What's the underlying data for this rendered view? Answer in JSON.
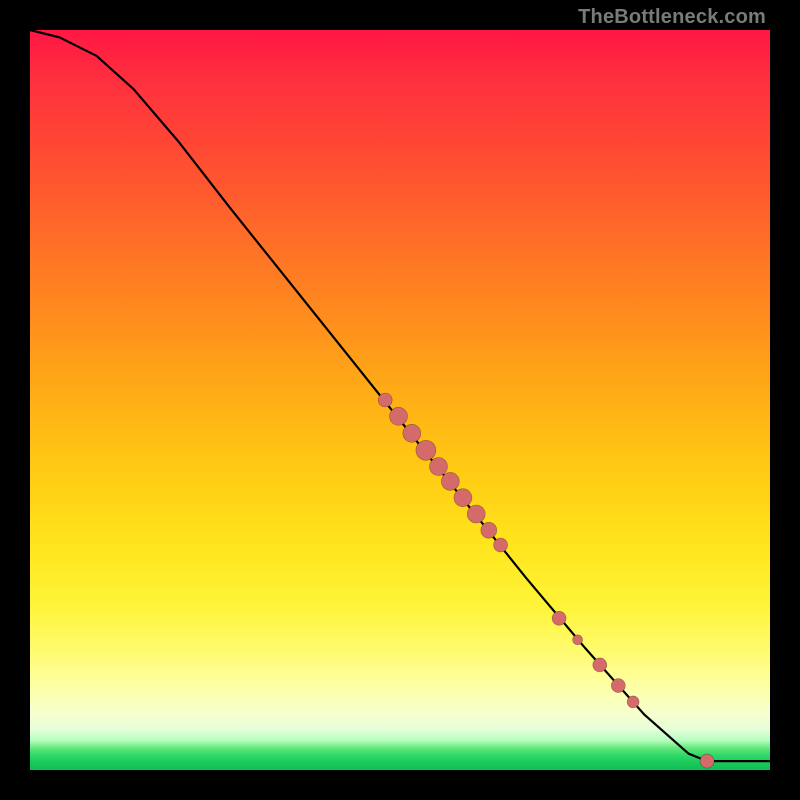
{
  "watermark": "TheBottleneck.com",
  "colors": {
    "dot": "#d46a6a",
    "curve": "#000000"
  },
  "chart_data": {
    "type": "scatter",
    "title": "",
    "xlabel": "",
    "ylabel": "",
    "xlim": [
      0,
      1
    ],
    "ylim": [
      0,
      1
    ],
    "curve": [
      [
        0.0,
        1.0
      ],
      [
        0.04,
        0.99
      ],
      [
        0.09,
        0.965
      ],
      [
        0.14,
        0.92
      ],
      [
        0.2,
        0.85
      ],
      [
        0.27,
        0.76
      ],
      [
        0.35,
        0.66
      ],
      [
        0.43,
        0.56
      ],
      [
        0.51,
        0.46
      ],
      [
        0.59,
        0.36
      ],
      [
        0.67,
        0.26
      ],
      [
        0.75,
        0.165
      ],
      [
        0.83,
        0.075
      ],
      [
        0.89,
        0.022
      ],
      [
        0.915,
        0.012
      ],
      [
        0.93,
        0.012
      ],
      [
        1.0,
        0.012
      ]
    ],
    "series": [
      {
        "name": "points",
        "points": [
          {
            "x": 0.48,
            "y": 0.5,
            "r": 7
          },
          {
            "x": 0.498,
            "y": 0.478,
            "r": 9
          },
          {
            "x": 0.516,
            "y": 0.455,
            "r": 9
          },
          {
            "x": 0.535,
            "y": 0.432,
            "r": 10
          },
          {
            "x": 0.552,
            "y": 0.41,
            "r": 9
          },
          {
            "x": 0.568,
            "y": 0.39,
            "r": 9
          },
          {
            "x": 0.585,
            "y": 0.368,
            "r": 9
          },
          {
            "x": 0.603,
            "y": 0.346,
            "r": 9
          },
          {
            "x": 0.62,
            "y": 0.324,
            "r": 8
          },
          {
            "x": 0.636,
            "y": 0.304,
            "r": 7
          },
          {
            "x": 0.715,
            "y": 0.205,
            "r": 7
          },
          {
            "x": 0.74,
            "y": 0.176,
            "r": 5
          },
          {
            "x": 0.77,
            "y": 0.142,
            "r": 7
          },
          {
            "x": 0.795,
            "y": 0.114,
            "r": 7
          },
          {
            "x": 0.815,
            "y": 0.092,
            "r": 6
          },
          {
            "x": 0.915,
            "y": 0.012,
            "r": 7
          }
        ]
      }
    ]
  }
}
